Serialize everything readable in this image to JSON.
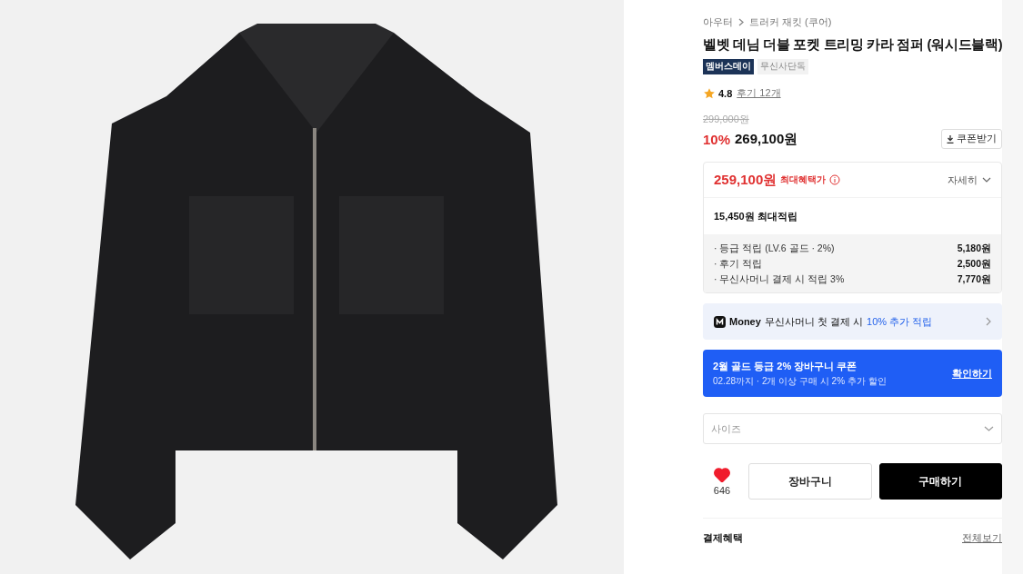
{
  "breadcrumb": [
    "아우터",
    "트러커 재킷 (쿠어)"
  ],
  "title": "벨벳 데님 더블 포켓 트리밍 카라 점퍼 (워시드블랙)",
  "badges": [
    {
      "label": "멤버스데이",
      "kind": "dark"
    },
    {
      "label": "무신사단독",
      "kind": "light"
    }
  ],
  "rating": {
    "score": "4.8",
    "reviews": "후기 12개"
  },
  "price": {
    "original": "299,000원",
    "discount": "10%",
    "sale": "269,100원"
  },
  "coupon_button": "쿠폰받기",
  "benefit": {
    "max_price": "259,100원",
    "max_label": "최대혜택가",
    "detail": "자세히",
    "points_total": "15,450원 최대적립",
    "items": [
      {
        "label": "· 등급 적립 (LV.6 골드 · 2%)",
        "amount": "5,180원"
      },
      {
        "label": "· 후기 적립",
        "amount": "2,500원"
      },
      {
        "label": "· 무신사머니 결제 시 적립 3%",
        "amount": "7,770원"
      }
    ]
  },
  "money_banner": {
    "logo": "Money",
    "text": "무신사머니 첫 결제 시",
    "highlight": "10% 추가 적립"
  },
  "coupon_banner": {
    "title": "2월 골드 등급 2% 장바구니 쿠폰",
    "subtitle": "02.28까지 · 2개 이상 구매 시 2% 추가 할인",
    "link": "확인하기"
  },
  "size_select": {
    "placeholder": "사이즈"
  },
  "like": {
    "count": "646",
    "liked": true
  },
  "cart_button": "장바구니",
  "buy_button": "구매하기",
  "payment": {
    "title": "결제혜택",
    "link": "전체보기"
  }
}
